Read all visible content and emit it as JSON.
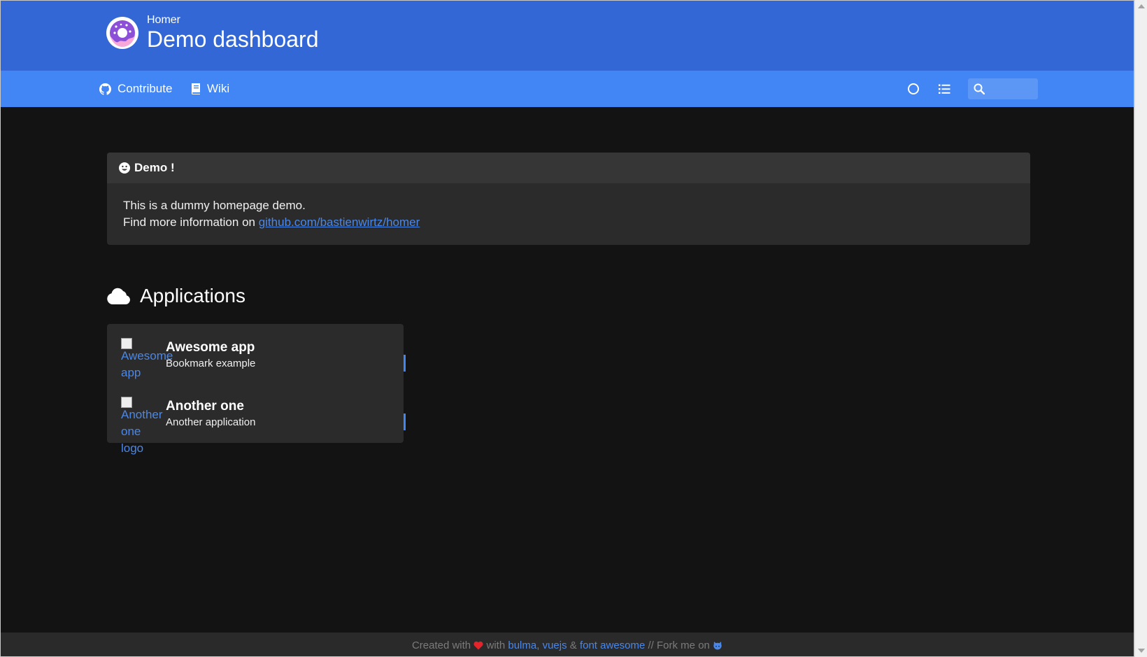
{
  "header": {
    "kicker": "Homer",
    "title": "Demo dashboard"
  },
  "navbar": {
    "links": [
      {
        "label": "Contribute",
        "icon": "github-icon"
      },
      {
        "label": "Wiki",
        "icon": "book-icon"
      }
    ],
    "search": {
      "placeholder": "",
      "value": ""
    }
  },
  "message": {
    "title": "Demo !",
    "line1": "This is a dummy homepage demo.",
    "line2_prefix": "Find more information on ",
    "link": "github.com/bastienwirtz/homer"
  },
  "applications": {
    "title": "Applications",
    "items": [
      {
        "name": "Awesome app",
        "subtitle": "Bookmark example",
        "logo_alt": "Awesome app"
      },
      {
        "name": "Another one",
        "subtitle": "Another application",
        "logo_alt": "Another one logo"
      }
    ]
  },
  "footer": {
    "created_with": "Created with",
    "with": "with",
    "bulma": "bulma",
    "comma": ",",
    "vuejs": "vuejs",
    "amp": "&",
    "font_awesome": "font awesome",
    "fork": "// Fork me on"
  },
  "colors": {
    "header_bg": "#3367d6",
    "navbar_bg": "#4285f4",
    "page_bg": "#131313",
    "card_bg": "#2b2b2b",
    "link": "#4a87e8",
    "heart": "#e3242b"
  }
}
